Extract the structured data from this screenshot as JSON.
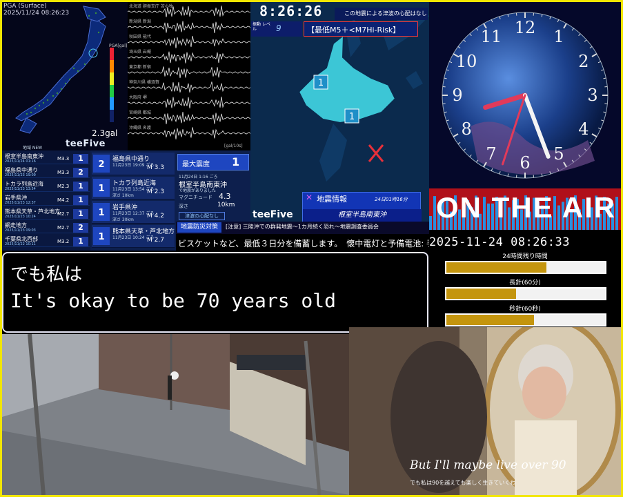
{
  "seismic_map": {
    "header_line1": "PGA (Surface)",
    "header_line2": "2025/11/24 08:26:23",
    "scale_label": "PGA[gal]",
    "gal_value": "2.3gal",
    "brand": "teeFive"
  },
  "waveform": {
    "stations": [
      "北海道 胆振支庁 苫小牧",
      "新潟県 新潟",
      "秋田県 能代",
      "埼玉県 岩槻",
      "東京都 新宿",
      "神奈川県 横須賀",
      "大阪府 堺",
      "宮崎県 都城",
      "沖縄県 名護"
    ],
    "unit": "[gal/10s]"
  },
  "quake_list": {
    "header": "地域 NEW",
    "items": [
      {
        "name": "根室半島南東沖",
        "date": "2025/11/24 01:16",
        "mag": "M3.3",
        "intensity": "1"
      },
      {
        "name": "福島県中通り",
        "date": "2025/11/23 19:09",
        "mag": "M3.3",
        "intensity": "2"
      },
      {
        "name": "トカラ列島近海",
        "date": "2025/11/23 13:54",
        "mag": "M2.3",
        "intensity": "1"
      },
      {
        "name": "岩手県沖",
        "date": "2025/11/23 12:37",
        "mag": "M4.2",
        "intensity": "1"
      },
      {
        "name": "熊本県天草・芦北地方",
        "date": "2025/11/23 10:24",
        "mag": "M2.7",
        "intensity": "1"
      },
      {
        "name": "網走地方",
        "date": "2025/11/23 09:03",
        "mag": "M2.7",
        "intensity": "2"
      },
      {
        "name": "千葉県北西部",
        "date": "2025/11/22 10:11",
        "mag": "M3.2",
        "intensity": "1"
      }
    ]
  },
  "detail_cards": [
    {
      "intensity": "2",
      "name": "福島県中通り",
      "time": "11月23日 19:09 ごろ",
      "depth": "",
      "mag": "M 3.3"
    },
    {
      "intensity": "1",
      "name": "トカラ列島近海",
      "time": "11月23日 13:54 ごろ",
      "depth": "深さ 10km",
      "mag": "M 2.3"
    },
    {
      "intensity": "1",
      "name": "岩手県沖",
      "time": "11月23日 12:37 ごろ",
      "depth": "深さ 30km",
      "mag": "M 4.2"
    },
    {
      "intensity": "1",
      "name": "熊本県天草・芦北地方",
      "time": "11月23日 10:24 ごろ",
      "depth": "",
      "mag": "M 2.7"
    }
  ],
  "max_intensity": {
    "label": "最大震度",
    "value": "1",
    "time": "11月24日 1:16 ごろ",
    "name": "根室半島南東沖",
    "sub": "で地震がありました",
    "mag_label": "マグニチュード",
    "mag": "4.3",
    "depth_label": "深さ",
    "depth": "10km",
    "tsunami": "津波の心配なし"
  },
  "hokkaido": {
    "clock": "8:26:26",
    "tsunami_note": "この地震による津波の心配はなし",
    "shindo_label": "振動 レベル",
    "shindo_value": "9",
    "risk": "【最低M5＋<M7Hi-Risk】",
    "markers": [
      "1",
      "1"
    ],
    "brand": "teeFive",
    "info_title": "地震情報",
    "info_time": "24日01時16分",
    "info_loc": "根室半島南東沖"
  },
  "analog_clock": {
    "numerals": [
      "12",
      "1",
      "2",
      "3",
      "4",
      "5",
      "6",
      "7",
      "8",
      "9",
      "10",
      "11"
    ],
    "hour": 8,
    "minute": 26,
    "second": 33
  },
  "on_air": "ON THE AIR",
  "ticker": {
    "tag": "地震防災対策",
    "text": "[注意] 三陸沖での群発地震～1カ月続く恐れ～地震調査委員会",
    "line2": "ビスケットなど、最低３日分を備蓄します。　懐中電灯と予備電池: 手"
  },
  "status": {
    "datetime": "2025-11-24 08:26:33",
    "bars": [
      {
        "label": "24時間残り時間",
        "progress": 0.63
      },
      {
        "label": "長針(60分)",
        "progress": 0.44
      },
      {
        "label": "秒針(60秒)",
        "progress": 0.55
      }
    ]
  },
  "subtitle": {
    "line1": "でも私は",
    "line2": "It's okay to be 70 years old"
  },
  "video": {
    "caption_en": "But I'll maybe live over 90",
    "caption_jp": "でも私は90を越えても楽しく生きていくわ"
  }
}
